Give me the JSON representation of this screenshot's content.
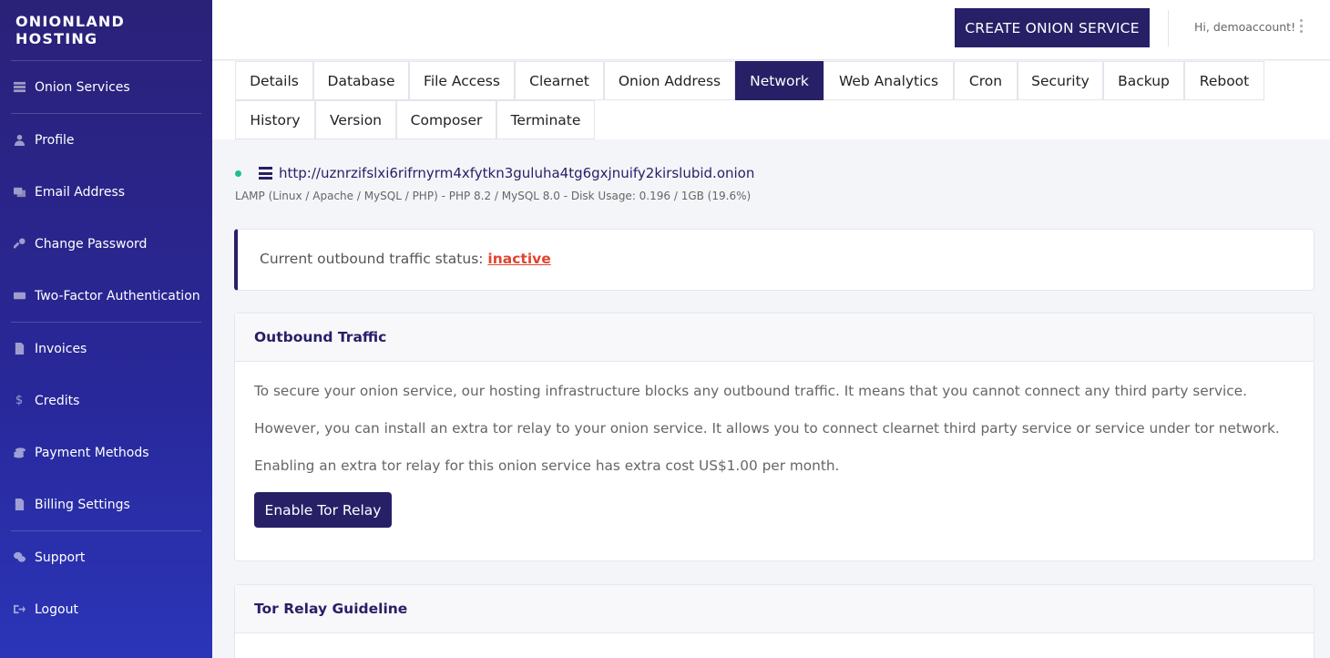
{
  "brand": "ONIONLAND HOSTING",
  "sidebar": {
    "items": [
      {
        "label": "Onion Services",
        "icon": "server-icon"
      },
      {
        "label": "Profile",
        "icon": "user-icon"
      },
      {
        "label": "Email Address",
        "icon": "envelope-icon"
      },
      {
        "label": "Change Password",
        "icon": "key-icon"
      },
      {
        "label": "Two-Factor Authentication",
        "icon": "keyboard-icon"
      },
      {
        "label": "Invoices",
        "icon": "file-invoice-icon"
      },
      {
        "label": "Credits",
        "icon": "dollar-icon",
        "glyph": "$"
      },
      {
        "label": "Payment Methods",
        "icon": "coins-icon"
      },
      {
        "label": "Billing Settings",
        "icon": "file-icon"
      },
      {
        "label": "Support",
        "icon": "comments-icon"
      },
      {
        "label": "Logout",
        "icon": "sign-out-icon"
      }
    ]
  },
  "header": {
    "create_button": "CREATE ONION SERVICE",
    "greeting": "Hi, demoaccount!"
  },
  "tabs": {
    "row1": [
      "Details",
      "Database",
      "File Access",
      "Clearnet",
      "Onion Address",
      "Network",
      "Web Analytics",
      "Cron",
      "Security",
      "Backup",
      "Reboot"
    ],
    "row2": [
      "History",
      "Version",
      "Composer",
      "Terminate"
    ],
    "active": "Network"
  },
  "service": {
    "url": "http://uznrzifslxi6rifrnyrm4xfytkn3guluha4tg6gxjnuify2kirslubid.onion",
    "stack": "LAMP (Linux / Apache / MySQL / PHP) - PHP 8.2 / MySQL 8.0 - Disk Usage: 0.196 / 1GB (19.6%)",
    "status_color": "#1fbf8f"
  },
  "status": {
    "label": "Current outbound traffic status: ",
    "value": "inactive"
  },
  "outbound_card": {
    "title": "Outbound Traffic",
    "paragraphs": [
      "To secure your onion service, our hosting infrastructure blocks any outbound traffic. It means that you cannot connect any third party service.",
      "However, you can install an extra tor relay to your onion service. It allows you to connect clearnet third party service or service under tor network.",
      "Enabling an extra tor relay for this onion service has extra cost US$1.00 per month."
    ],
    "button": "Enable Tor Relay"
  },
  "guideline_card": {
    "title": "Tor Relay Guideline"
  },
  "colors": {
    "primary": "#272067",
    "inactive": "#e0442d"
  }
}
